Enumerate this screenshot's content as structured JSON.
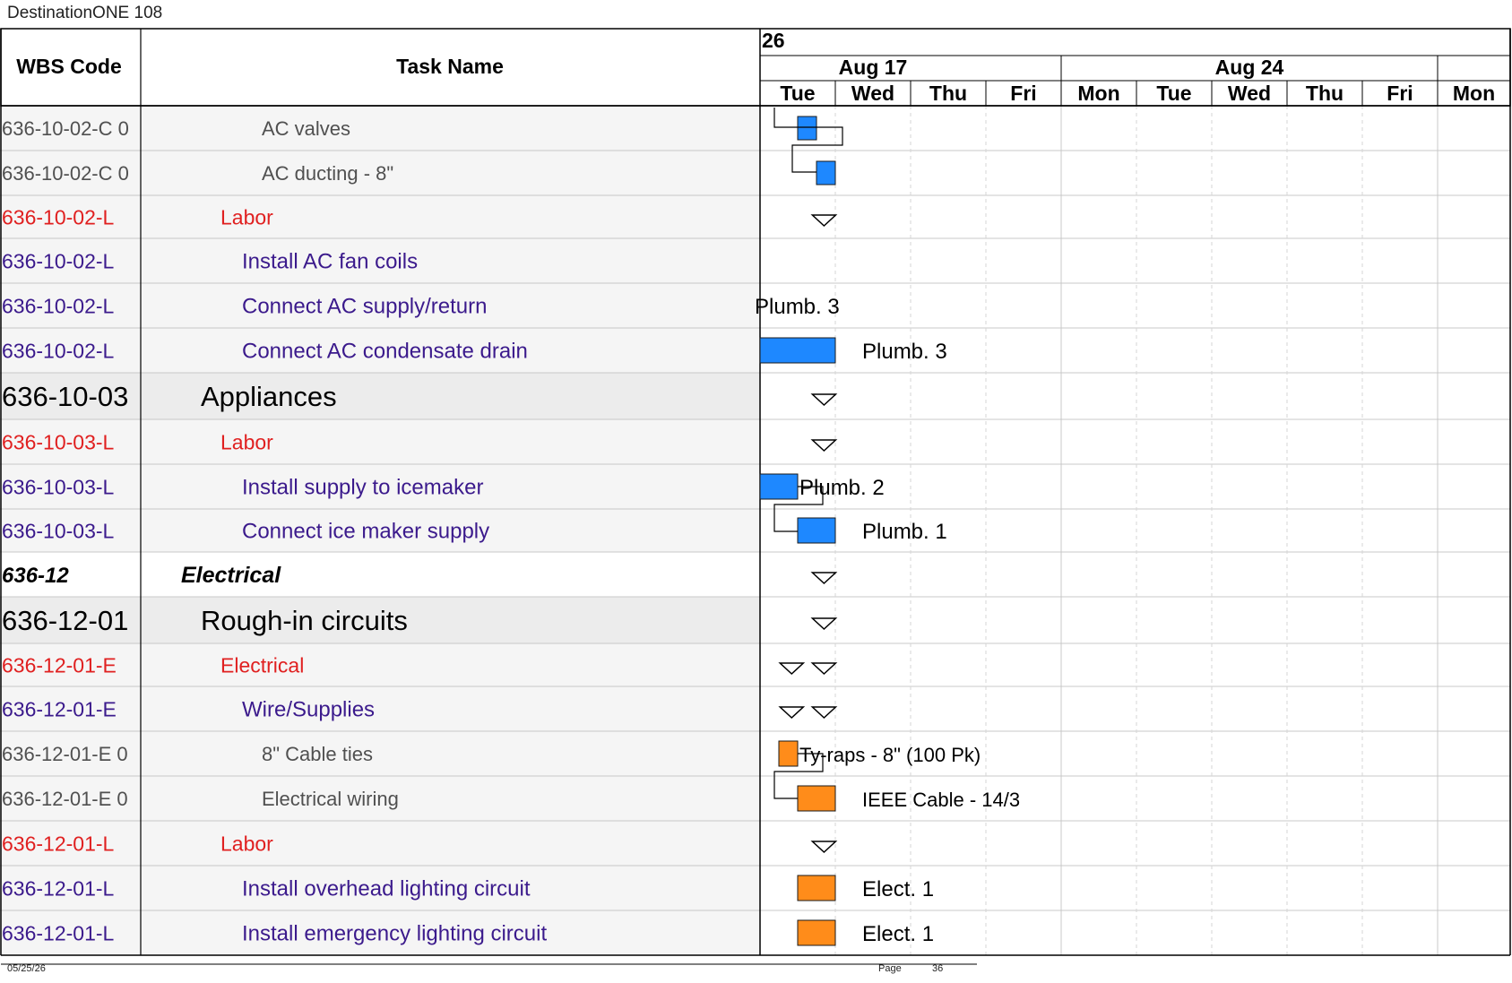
{
  "app_title": "DestinationONE 108",
  "columns": {
    "wbs": "WBS Code",
    "task": "Task Name"
  },
  "timeline": {
    "year_fragment": "26",
    "weeks": [
      "Aug 17",
      "Aug 24"
    ],
    "days": [
      "Tue",
      "Wed",
      "Thu",
      "Fri",
      "Mon",
      "Tue",
      "Wed",
      "Thu",
      "Fri",
      "Mon"
    ]
  },
  "colors": {
    "labor_bar": "#1e88ff",
    "material_bar": "#ff8c1a",
    "labor_code": "#e02020",
    "task_blue": "#3b1a8c",
    "material_text": "#505050"
  },
  "rows": [
    {
      "wbs": "636-10-02-C 0",
      "task": "AC valves",
      "style": "material",
      "bar": {
        "type": "material_box",
        "day_start": 0.5,
        "day_end": 0.75,
        "color": "labor"
      },
      "label": ""
    },
    {
      "wbs": "636-10-02-C 0",
      "task": "AC ducting - 8\"",
      "style": "material",
      "bar": {
        "type": "material_box",
        "day_start": 0.75,
        "day_end": 1.0,
        "color": "labor"
      },
      "label": ""
    },
    {
      "wbs": "636-10-02-L",
      "task": "Labor",
      "style": "labor",
      "bar": {
        "type": "summary",
        "days": [
          0.85
        ]
      },
      "label": ""
    },
    {
      "wbs": "636-10-02-L",
      "task": "Install AC fan coils",
      "style": "task",
      "bar": null,
      "label": ""
    },
    {
      "wbs": "636-10-02-L",
      "task": "Connect AC supply/return",
      "style": "task",
      "bar": null,
      "label": "Plumb. 3"
    },
    {
      "wbs": "636-10-02-L",
      "task": "Connect AC condensate drain",
      "style": "task",
      "bar": {
        "type": "task",
        "day_start": 0,
        "day_end": 1.0,
        "color": "labor"
      },
      "label": "Plumb. 3"
    },
    {
      "wbs": "636-10-03",
      "task": "Appliances",
      "style": "group",
      "bar": {
        "type": "summary",
        "days": [
          0.85
        ]
      },
      "label": ""
    },
    {
      "wbs": "636-10-03-L",
      "task": "Labor",
      "style": "labor",
      "bar": {
        "type": "summary",
        "days": [
          0.85
        ]
      },
      "label": ""
    },
    {
      "wbs": "636-10-03-L",
      "task": "Install supply to icemaker",
      "style": "task",
      "bar": {
        "type": "task",
        "day_start": 0,
        "day_end": 0.5,
        "color": "labor"
      },
      "label": "Plumb. 2"
    },
    {
      "wbs": "636-10-03-L",
      "task": "Connect ice maker supply",
      "style": "task",
      "bar": {
        "type": "task",
        "day_start": 0.5,
        "day_end": 1.0,
        "color": "labor"
      },
      "label": "Plumb. 1"
    },
    {
      "wbs": "636-12",
      "task": "Electrical",
      "style": "section",
      "bar": {
        "type": "summary",
        "days": [
          0.85
        ]
      },
      "label": ""
    },
    {
      "wbs": "636-12-01",
      "task": "Rough-in circuits",
      "style": "group",
      "bar": {
        "type": "summary",
        "days": [
          0.85
        ]
      },
      "label": ""
    },
    {
      "wbs": "636-12-01-E",
      "task": "Electrical",
      "style": "labor",
      "bar": {
        "type": "summary",
        "days": [
          0.42,
          0.85
        ]
      },
      "label": ""
    },
    {
      "wbs": "636-12-01-E",
      "task": "Wire/Supplies",
      "style": "task",
      "bar": {
        "type": "summary",
        "days": [
          0.42,
          0.85
        ]
      },
      "label": ""
    },
    {
      "wbs": "636-12-01-E 0",
      "task": "8\" Cable ties",
      "style": "material",
      "bar": {
        "type": "task",
        "day_start": 0.25,
        "day_end": 0.5,
        "color": "material"
      },
      "label": "Ty-raps - 8\"  (100 Pk)"
    },
    {
      "wbs": "636-12-01-E 0",
      "task": "Electrical wiring",
      "style": "material",
      "bar": {
        "type": "task",
        "day_start": 0.5,
        "day_end": 1.0,
        "color": "material"
      },
      "label": "IEEE Cable - 14/3"
    },
    {
      "wbs": "636-12-01-L",
      "task": "Labor",
      "style": "labor",
      "bar": {
        "type": "summary",
        "days": [
          0.85
        ]
      },
      "label": ""
    },
    {
      "wbs": "636-12-01-L",
      "task": "Install overhead lighting circuit",
      "style": "task",
      "bar": {
        "type": "task",
        "day_start": 0.5,
        "day_end": 1.0,
        "color": "material"
      },
      "label": "Elect. 1"
    },
    {
      "wbs": "636-12-01-L",
      "task": "Install emergency lighting circuit",
      "style": "task",
      "bar": {
        "type": "task",
        "day_start": 0.5,
        "day_end": 1.0,
        "color": "material"
      },
      "label": "Elect. 1"
    }
  ],
  "footer": {
    "date": "05/25/26",
    "page_label": "Page",
    "page_number": "36"
  }
}
